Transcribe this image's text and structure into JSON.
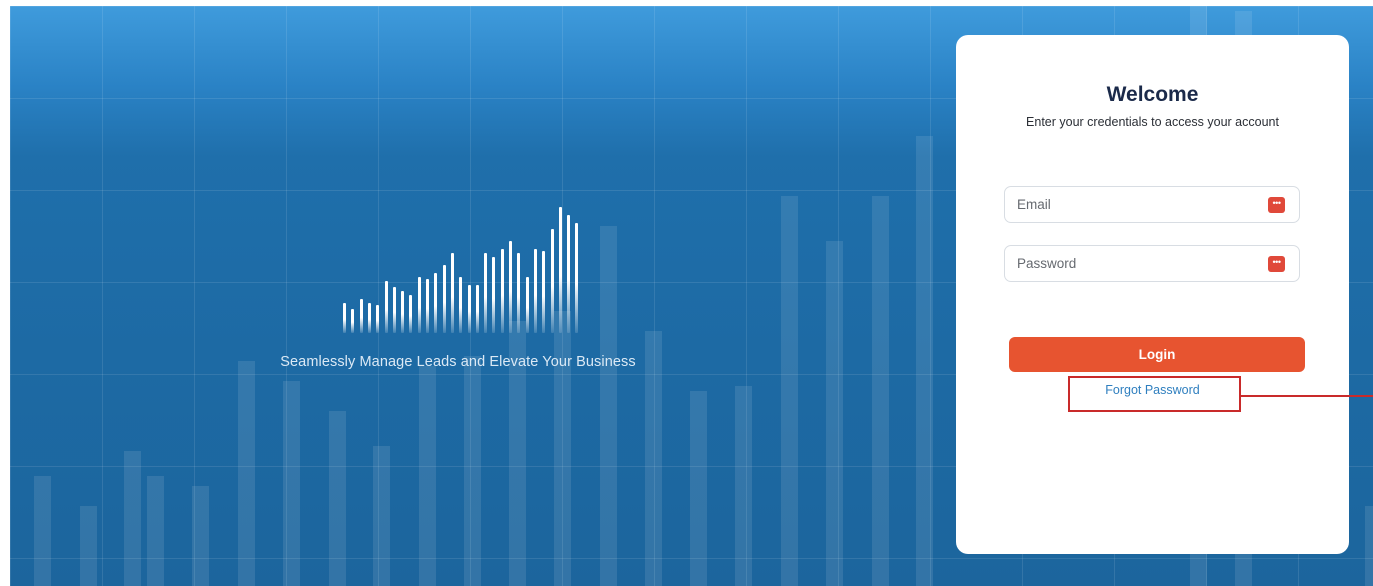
{
  "hero": {
    "tagline": "Seamlessly Manage Leads and Elevate Your Business"
  },
  "login": {
    "title": "Welcome",
    "subtitle": "Enter your credentials to access your account",
    "email_placeholder": "Email",
    "password_placeholder": "Password",
    "login_label": "Login",
    "forgot_label": "Forgot Password"
  },
  "icons": {
    "field_icon": "password-manager-icon"
  },
  "colors": {
    "accent": "#e75430",
    "link": "#2f7fbf",
    "title": "#1b2a4a",
    "hero_blue": "#1d6aa4",
    "annotation": "#c92a2a"
  }
}
